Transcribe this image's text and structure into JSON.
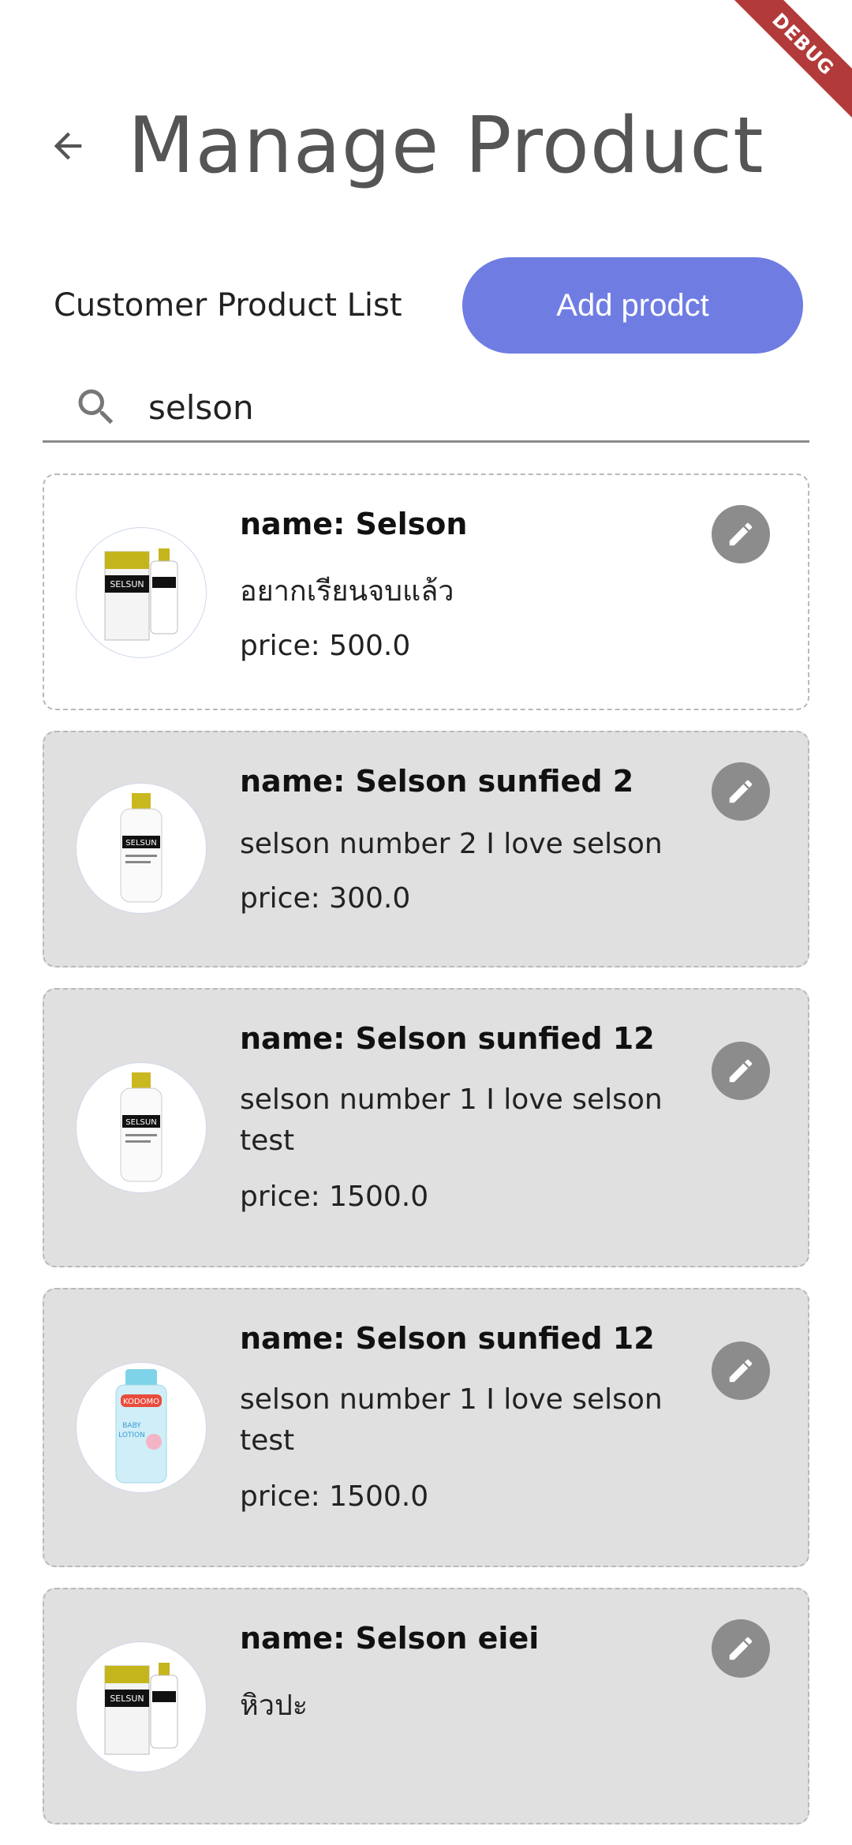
{
  "debug_banner": "DEBUG",
  "header": {
    "title": "Manage Product"
  },
  "toolbar": {
    "list_label": "Customer Product List",
    "add_button": "Add prodct"
  },
  "search": {
    "value": "selson",
    "placeholder": ""
  },
  "products": [
    {
      "name": "name: Selson",
      "description": "อยากเรียนจบแล้ว",
      "price": "price: 500.0",
      "image": "selsun-two-bottles"
    },
    {
      "name": "name: Selson sunfied 2",
      "description": "selson number 2 I love selson",
      "price": "price: 300.0",
      "image": "selsun-bottle"
    },
    {
      "name": "name: Selson sunfied 12",
      "description": "selson number 1 I love selson test",
      "price": "price: 1500.0",
      "image": "selsun-bottle"
    },
    {
      "name": "name: Selson sunfied 12",
      "description": "selson number 1 I love selson test",
      "price": "price: 1500.0",
      "image": "kodomo-lotion-bottle"
    },
    {
      "name": "name: Selson eiei",
      "description": "หิวปะ",
      "price": "",
      "image": "selsun-two-bottles"
    }
  ],
  "colors": {
    "accent": "#6f7de3",
    "card_grey": "#e0e0e0",
    "edit_button": "#8c8c8c",
    "title": "#555555"
  }
}
